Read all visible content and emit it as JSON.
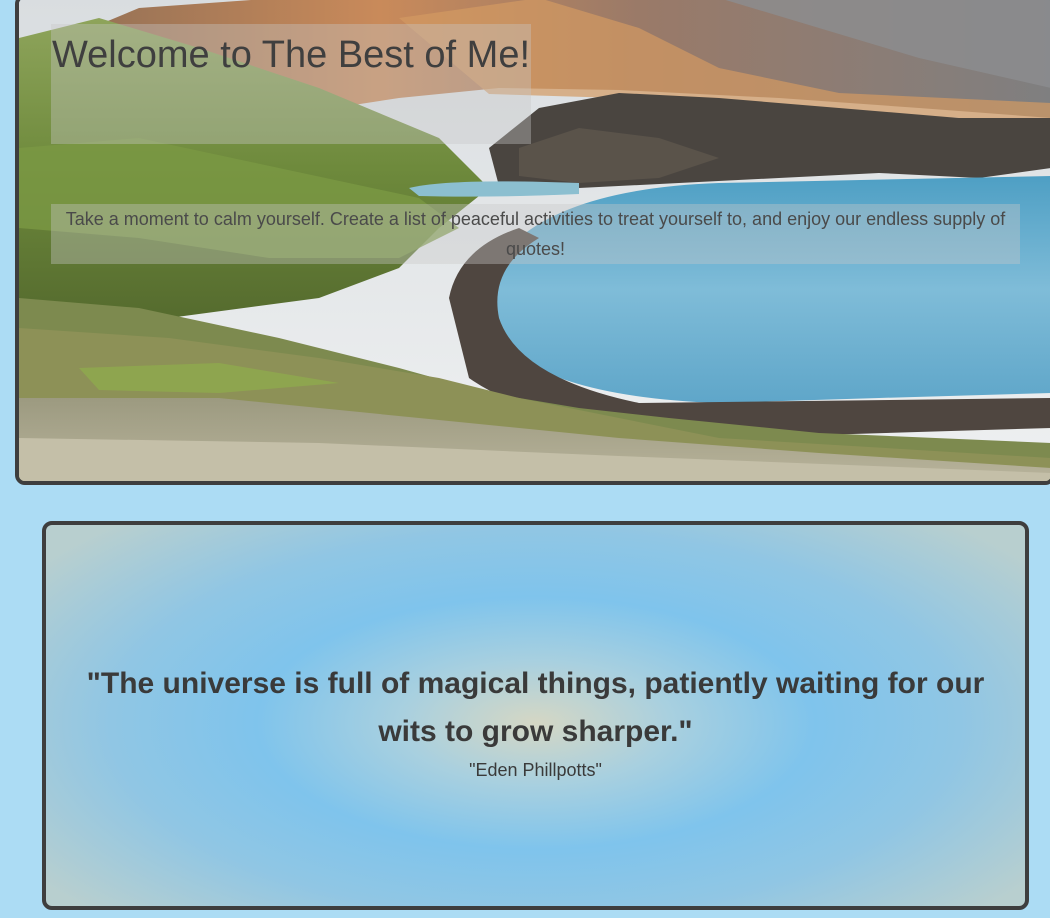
{
  "hero": {
    "title": "Welcome to The Best of Me!",
    "subtitle": "Take a moment to calm yourself. Create a list of peaceful activities to treat yourself to, and enjoy our endless supply of quotes!",
    "image_description": "mountain-lake-landscape"
  },
  "quote": {
    "text": "\"The universe is full of magical things, patiently waiting for our wits to grow sharper.\"",
    "author": "\"Eden Phillpotts\""
  },
  "colors": {
    "page_background": "#acdcf4",
    "border": "#3e3e3e",
    "text": "#3a3a3a"
  }
}
